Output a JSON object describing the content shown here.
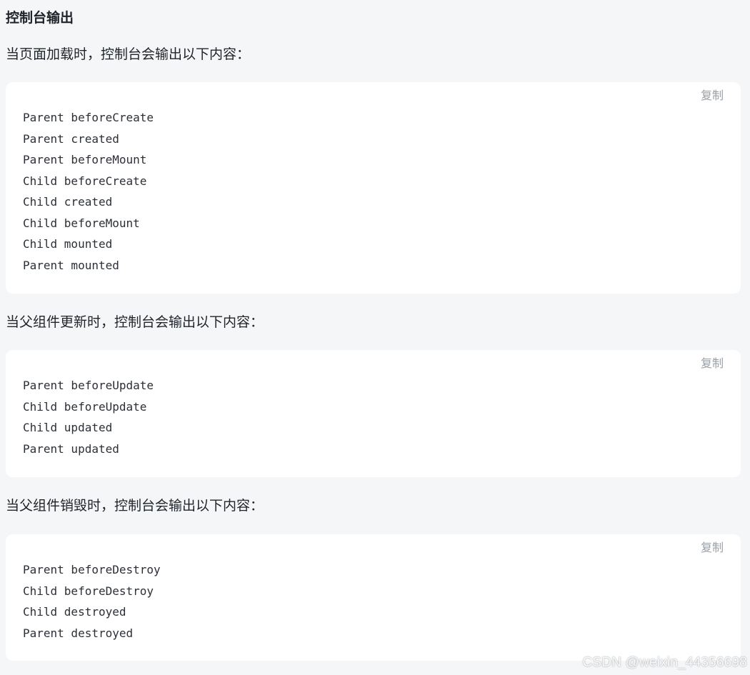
{
  "heading": "控制台输出",
  "sections": [
    {
      "intro": "当页面加载时，控制台会输出以下内容：",
      "copy_label": "复制",
      "lines": [
        "Parent beforeCreate",
        "Parent created",
        "Parent beforeMount",
        "Child beforeCreate",
        "Child created",
        "Child beforeMount",
        "Child mounted",
        "Parent mounted"
      ]
    },
    {
      "intro": "当父组件更新时，控制台会输出以下内容：",
      "copy_label": "复制",
      "lines": [
        "Parent beforeUpdate",
        "Child beforeUpdate",
        "Child updated",
        "Parent updated"
      ]
    },
    {
      "intro": "当父组件销毁时，控制台会输出以下内容：",
      "copy_label": "复制",
      "lines": [
        "Parent beforeDestroy",
        "Child beforeDestroy",
        "Child destroyed",
        "Parent destroyed"
      ]
    }
  ],
  "watermark": "CSDN @weixin_44356698"
}
